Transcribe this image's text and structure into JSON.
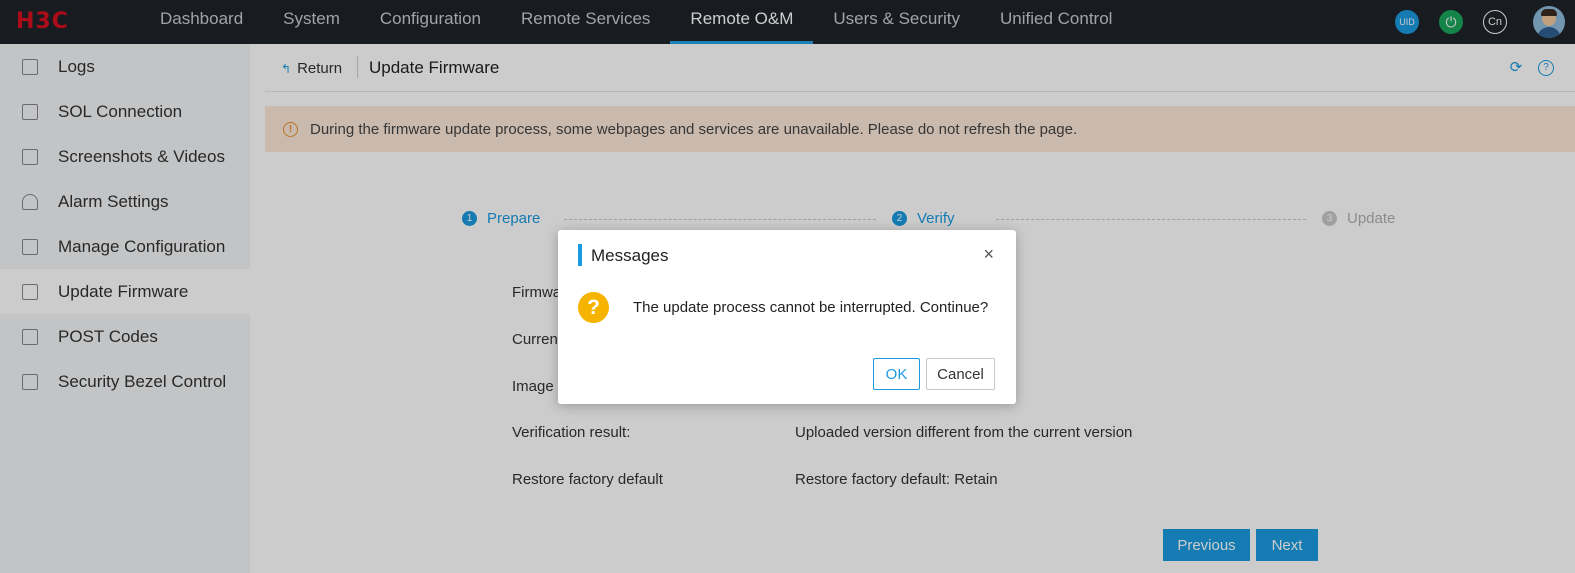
{
  "header": {
    "logo": "H3C",
    "nav": [
      "Dashboard",
      "System",
      "Configuration",
      "Remote Services",
      "Remote O&M",
      "Users & Security",
      "Unified Control"
    ],
    "active_nav": "Remote O&M",
    "icons": {
      "uid": "UID",
      "power": "power-icon",
      "lang": "Cn",
      "avatar": "user-avatar"
    }
  },
  "sidebar": {
    "items": [
      {
        "label": "Logs",
        "icon": "log-icon"
      },
      {
        "label": "SOL Connection",
        "icon": "sol-icon"
      },
      {
        "label": "Screenshots & Videos",
        "icon": "video-icon"
      },
      {
        "label": "Alarm Settings",
        "icon": "bell-icon"
      },
      {
        "label": "Manage Configuration",
        "icon": "config-icon"
      },
      {
        "label": "Update Firmware",
        "icon": "chip-icon"
      },
      {
        "label": "POST Codes",
        "icon": "code-icon"
      },
      {
        "label": "Security Bezel Control",
        "icon": "bezel-icon"
      }
    ],
    "active": "Update Firmware"
  },
  "main": {
    "return_label": "Return",
    "title": "Update Firmware",
    "warning": "During the firmware update process, some webpages and services are unavailable. Please do not refresh the page.",
    "steps": [
      {
        "num": "1",
        "label": "Prepare",
        "state": "done"
      },
      {
        "num": "2",
        "label": "Verify",
        "state": "done"
      },
      {
        "num": "3",
        "label": "Update",
        "state": "pending"
      }
    ],
    "rows": [
      {
        "label": "Firmwa",
        "value": ""
      },
      {
        "label": "Current",
        "value": ""
      },
      {
        "label": "Image",
        "value": ""
      },
      {
        "label": "Verification result:",
        "value": "Uploaded version different from the current version"
      },
      {
        "label": "Restore factory default",
        "value": "Restore factory default: Retain"
      }
    ],
    "previous_label": "Previous",
    "next_label": "Next"
  },
  "dialog": {
    "title": "Messages",
    "message": "The update process cannot be interrupted. Continue?",
    "ok_label": "OK",
    "cancel_label": "Cancel"
  },
  "colors": {
    "accent": "#1a9be0",
    "topbar": "#1f2329",
    "warning_bg": "#fde9d9",
    "logo": "#d7101d"
  }
}
